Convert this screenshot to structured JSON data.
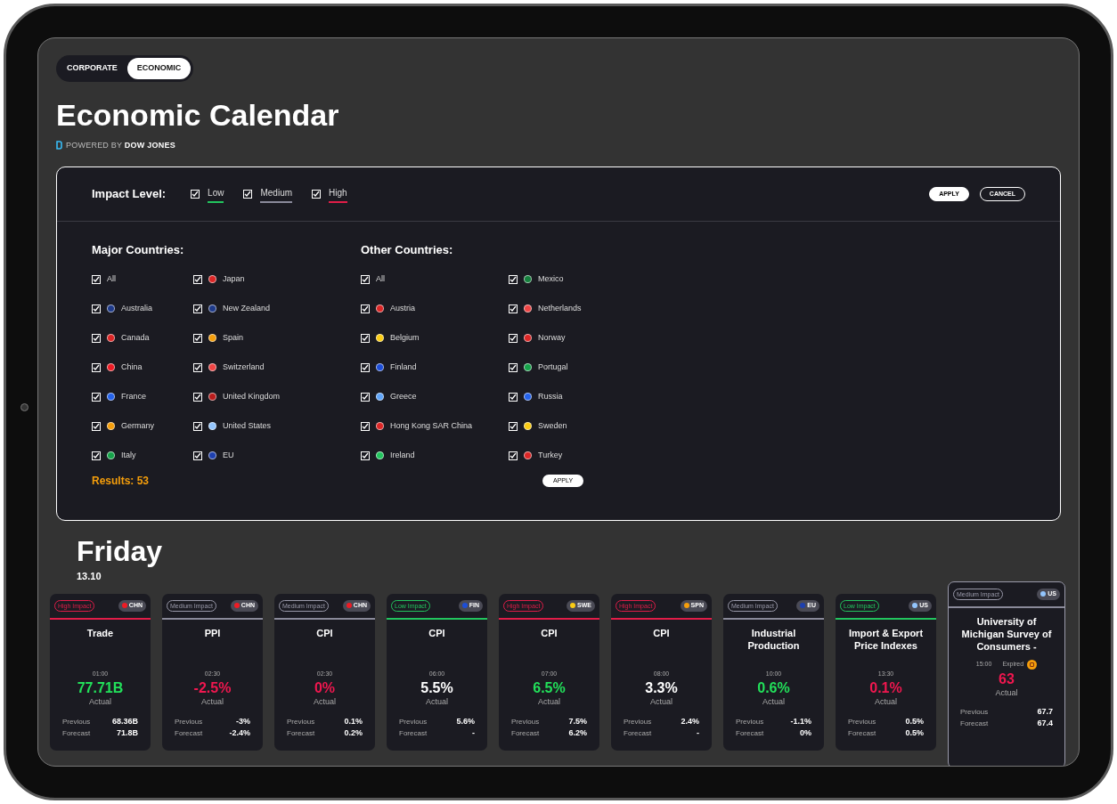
{
  "tabs": [
    {
      "label": "CORPORATE",
      "selected": false
    },
    {
      "label": "ECONOMIC",
      "selected": true
    }
  ],
  "title": "Economic Calendar",
  "powered_by": {
    "prefix": "POWERED BY",
    "brand": "DOW JONES"
  },
  "filters": {
    "impact_label": "Impact Level:",
    "impact_levels": [
      {
        "label": "Low",
        "kind": "low",
        "checked": true
      },
      {
        "label": "Medium",
        "kind": "medium",
        "checked": true
      },
      {
        "label": "High",
        "kind": "high",
        "checked": true
      }
    ],
    "buttons": [
      {
        "label": "APPLY",
        "kind": "primary"
      },
      {
        "label": "CANCEL",
        "kind": "outline"
      }
    ],
    "groups": [
      {
        "title": "Major Countries:",
        "columns": [
          [
            {
              "label": "All",
              "checked": true
            },
            {
              "label": "Australia",
              "checked": true,
              "color": "#1e3a8a"
            },
            {
              "label": "Canada",
              "checked": true,
              "color": "#dc2626"
            },
            {
              "label": "China",
              "checked": true,
              "color": "#ee1c25"
            },
            {
              "label": "France",
              "checked": true,
              "color": "#2563eb"
            },
            {
              "label": "Germany",
              "checked": true,
              "color": "#f59e0b"
            },
            {
              "label": "Italy",
              "checked": true,
              "color": "#16a34a"
            }
          ],
          [
            {
              "label": "Japan",
              "checked": true,
              "color": "#dc2626"
            },
            {
              "label": "New Zealand",
              "checked": true,
              "color": "#1e3a8a"
            },
            {
              "label": "Spain",
              "checked": true,
              "color": "#f59e0b"
            },
            {
              "label": "Switzerland",
              "checked": true,
              "color": "#ef4444"
            },
            {
              "label": "United Kingdom",
              "checked": true,
              "color": "#b91c1c"
            },
            {
              "label": "United States",
              "checked": true,
              "color": "#93c5fd"
            },
            {
              "label": "EU",
              "checked": true,
              "color": "#1e40af"
            }
          ]
        ]
      },
      {
        "title": "Other Countries:",
        "columns": [
          [
            {
              "label": "All",
              "checked": true
            },
            {
              "label": "Austria",
              "checked": true,
              "color": "#dc2626"
            },
            {
              "label": "Belgium",
              "checked": true,
              "color": "#facc15"
            },
            {
              "label": "Finland",
              "checked": true,
              "color": "#1d4ed8"
            },
            {
              "label": "Greece",
              "checked": true,
              "color": "#60a5fa"
            },
            {
              "label": "Hong Kong SAR China",
              "checked": true,
              "color": "#dc2626"
            },
            {
              "label": "Ireland",
              "checked": true,
              "color": "#22c55e"
            }
          ],
          [
            {
              "label": "Mexico",
              "checked": true,
              "color": "#15803d"
            },
            {
              "label": "Netherlands",
              "checked": true,
              "color": "#ef4444"
            },
            {
              "label": "Norway",
              "checked": true,
              "color": "#dc2626"
            },
            {
              "label": "Portugal",
              "checked": true,
              "color": "#16a34a"
            },
            {
              "label": "Russia",
              "checked": true,
              "color": "#2563eb"
            },
            {
              "label": "Sweden",
              "checked": true,
              "color": "#facc15"
            },
            {
              "label": "Turkey",
              "checked": true,
              "color": "#dc2626"
            }
          ]
        ]
      }
    ],
    "results": "Results: 53",
    "bottom_button": "APPLY"
  },
  "day": {
    "name": "Friday",
    "date": "13.10"
  },
  "events": [
    {
      "impact": {
        "label": "High Impact",
        "kind": "high"
      },
      "country": {
        "code": "CHN",
        "color": "#ee1c25"
      },
      "title": "Trade",
      "time": "01:00",
      "actual": {
        "value": "77.71B",
        "kind": "positive"
      },
      "actual_label": "Actual",
      "previous_label": "Previous",
      "previous": "68.36B",
      "forecast_label": "Forecast",
      "forecast": "71.8B",
      "selected": false
    },
    {
      "impact": {
        "label": "Medium Impact",
        "kind": "medium"
      },
      "country": {
        "code": "CHN",
        "color": "#ee1c25"
      },
      "title": "PPI",
      "time": "02:30",
      "actual": {
        "value": "-2.5%",
        "kind": "negative"
      },
      "actual_label": "Actual",
      "previous_label": "Previous",
      "previous": "-3%",
      "forecast_label": "Forecast",
      "forecast": "-2.4%",
      "selected": false
    },
    {
      "impact": {
        "label": "Medium Impact",
        "kind": "medium"
      },
      "country": {
        "code": "CHN",
        "color": "#ee1c25"
      },
      "title": "CPI",
      "time": "02:30",
      "actual": {
        "value": "0%",
        "kind": "negative"
      },
      "actual_label": "Actual",
      "previous_label": "Previous",
      "previous": "0.1%",
      "forecast_label": "Forecast",
      "forecast": "0.2%",
      "selected": false
    },
    {
      "impact": {
        "label": "Low Impact",
        "kind": "low"
      },
      "country": {
        "code": "FIN",
        "color": "#1d4ed8"
      },
      "title": "CPI",
      "time": "06:00",
      "actual": {
        "value": "5.5%",
        "kind": "neutral"
      },
      "actual_label": "Actual",
      "previous_label": "Previous",
      "previous": "5.6%",
      "forecast_label": "Forecast",
      "forecast": "-",
      "selected": false
    },
    {
      "impact": {
        "label": "High Impact",
        "kind": "high"
      },
      "country": {
        "code": "SWE",
        "color": "#facc15"
      },
      "title": "CPI",
      "time": "07:00",
      "actual": {
        "value": "6.5%",
        "kind": "positive"
      },
      "actual_label": "Actual",
      "previous_label": "Previous",
      "previous": "7.5%",
      "forecast_label": "Forecast",
      "forecast": "6.2%",
      "selected": false
    },
    {
      "impact": {
        "label": "High Impact",
        "kind": "high"
      },
      "country": {
        "code": "SPN",
        "color": "#f59e0b"
      },
      "title": "CPI",
      "time": "08:00",
      "actual": {
        "value": "3.3%",
        "kind": "neutral"
      },
      "actual_label": "Actual",
      "previous_label": "Previous",
      "previous": "2.4%",
      "forecast_label": "Forecast",
      "forecast": "-",
      "selected": false
    },
    {
      "impact": {
        "label": "Medium Impact",
        "kind": "medium"
      },
      "country": {
        "code": "EU",
        "color": "#1e40af"
      },
      "title": "Industrial Production",
      "time": "10:00",
      "actual": {
        "value": "0.6%",
        "kind": "positive"
      },
      "actual_label": "Actual",
      "previous_label": "Previous",
      "previous": "-1.1%",
      "forecast_label": "Forecast",
      "forecast": "0%",
      "selected": false
    },
    {
      "impact": {
        "label": "Low Impact",
        "kind": "low"
      },
      "country": {
        "code": "US",
        "color": "#93c5fd"
      },
      "title": "Import & Export Price Indexes",
      "time": "13:30",
      "actual": {
        "value": "0.1%",
        "kind": "negative"
      },
      "actual_label": "Actual",
      "previous_label": "Previous",
      "previous": "0.5%",
      "forecast_label": "Forecast",
      "forecast": "0.5%",
      "selected": false
    },
    {
      "impact": {
        "label": "Medium Impact",
        "kind": "medium"
      },
      "country": {
        "code": "US",
        "color": "#93c5fd"
      },
      "title": "University of Michigan Survey of Consumers -",
      "time": "15:00",
      "status": "Expired",
      "actual": {
        "value": "63",
        "kind": "negative"
      },
      "actual_label": "Actual",
      "previous_label": "Previous",
      "previous": "67.7",
      "forecast_label": "Forecast",
      "forecast": "67.4",
      "selected": true
    }
  ]
}
